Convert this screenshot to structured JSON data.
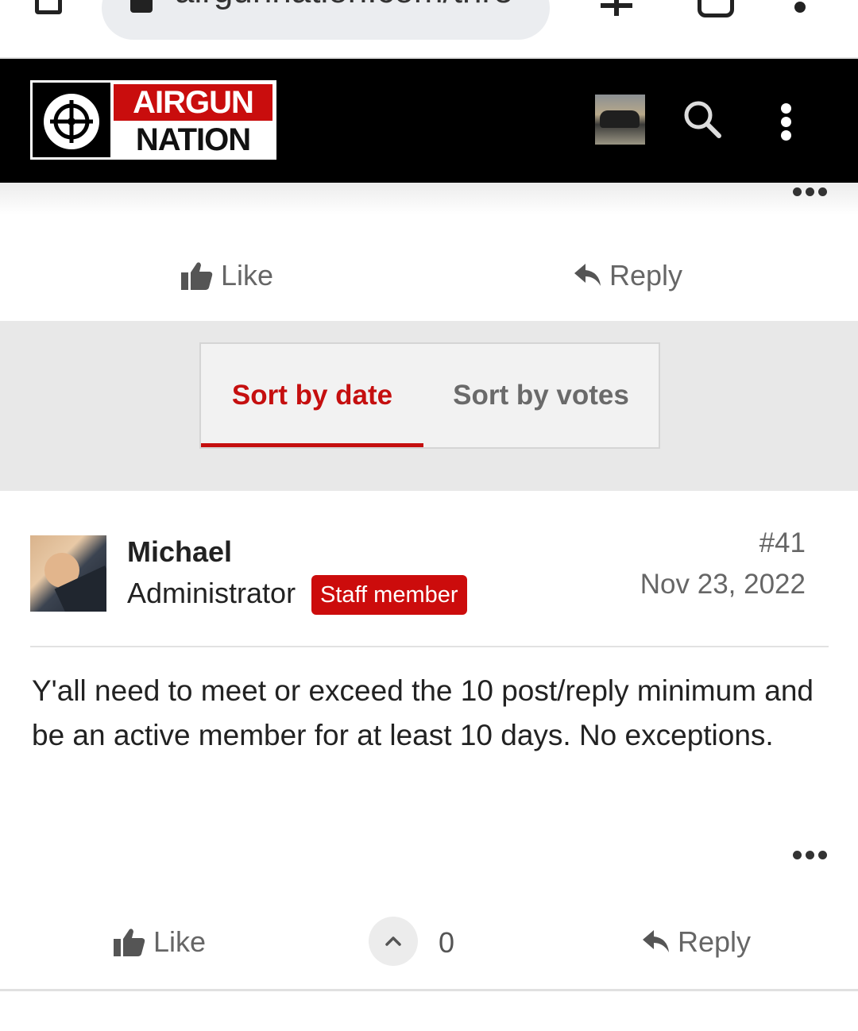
{
  "browser": {
    "url": "airgunnation.com/thre"
  },
  "site": {
    "logo_top": "AIRGUN",
    "logo_bottom": "NATION"
  },
  "previous_post": {
    "like_label": "Like",
    "reply_label": "Reply"
  },
  "sort": {
    "tabs": [
      {
        "label": "Sort by date",
        "active": true
      },
      {
        "label": "Sort by votes",
        "active": false
      }
    ]
  },
  "post": {
    "username": "Michael",
    "role": "Administrator",
    "badge": "Staff member",
    "number": "#41",
    "date": "Nov 23, 2022",
    "body": "Y'all need to meet or exceed the 10 post/reply minimum and be an active member for at least 10 days. No exceptions.",
    "like_label": "Like",
    "vote_count": "0",
    "reply_label": "Reply"
  },
  "colors": {
    "brand_red": "#c50f0f",
    "header_bg": "#000000",
    "sort_bg": "#e8e8e8"
  },
  "icons": [
    "tab-icon",
    "lock-icon",
    "plus-icon",
    "tabs-count-icon",
    "browser-menu-icon",
    "search-icon",
    "kebab-menu-icon",
    "more-dots-icon",
    "thumbs-up-icon",
    "reply-arrow-icon",
    "chevron-up-icon"
  ]
}
